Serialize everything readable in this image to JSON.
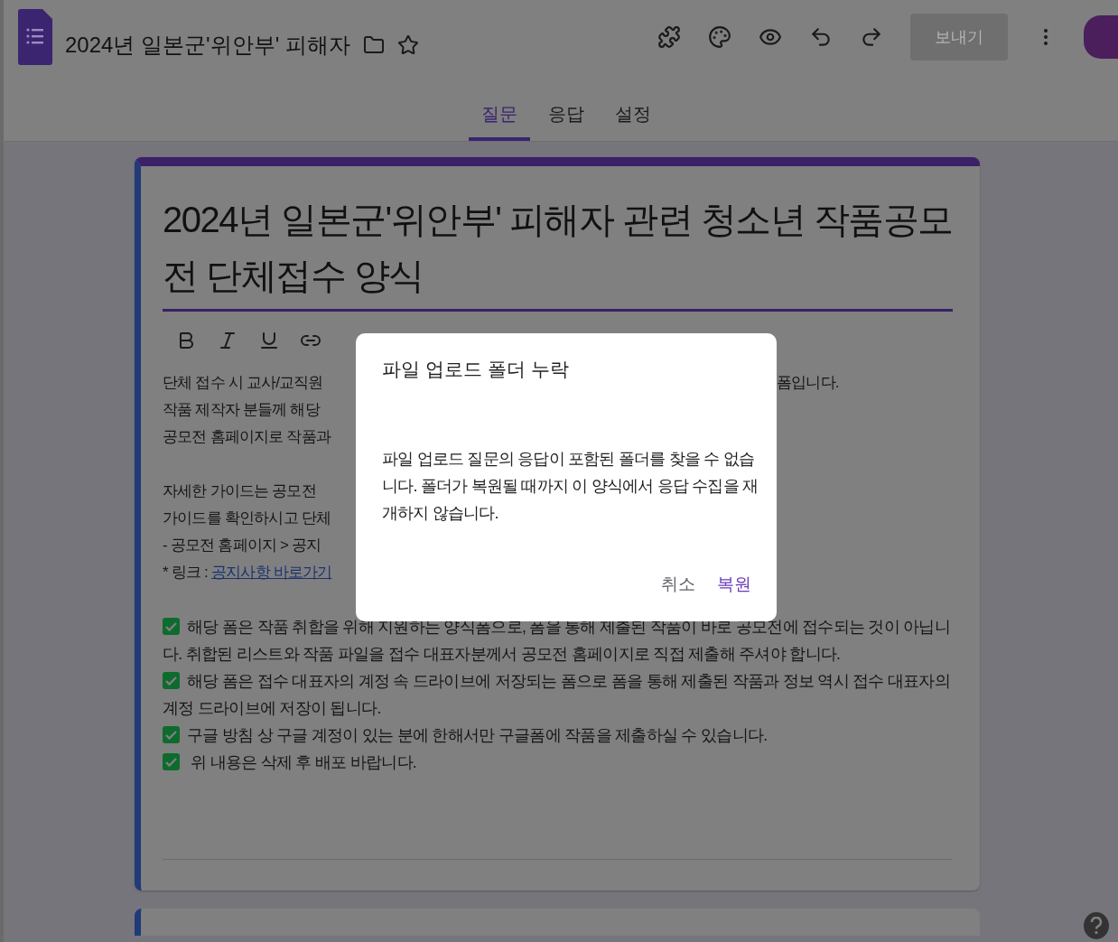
{
  "header": {
    "title": "2024년 일본군'위안부' 피해자",
    "send_button": "보내기"
  },
  "tabs": [
    {
      "label": "질문",
      "selected": true
    },
    {
      "label": "응답",
      "selected": false
    },
    {
      "label": "설정",
      "selected": false
    }
  ],
  "form": {
    "title": "2024년 일본군'위안부' 피해자 관련 청소년 작품공모전 단체접수 양식",
    "description_paragraphs": [
      [
        "단체 접수 시 교사/교직원",
        "작품 제작자 분들께 해당",
        "공모전 홈페이지로 작품과"
      ],
      [
        "자세한 가이드는 공모전",
        "가이드를 확인하시고 단체",
        "- 공모전 홈페이지 > 공지"
      ]
    ],
    "description_right": "폼입니다.",
    "link_line": {
      "label": "* 링크 : ",
      "link": "공지사항 바로가기"
    },
    "notices": [
      {
        "checked": true,
        "text": "해당 폼은 작품 취합을 위해 지원하는 양식폼으로, 폼을 통해 제출된 작품이 바로 공모전에 접수되는 것이 아닙니다. 취합된 리스트와 작품 파일을 접수 대표자분께서 공모전 홈페이지로 직접 제출해 주셔야 합니다."
      },
      {
        "checked": true,
        "text": "해당 폼은 접수 대표자의 계정 속 드라이브에 저장되는 폼으로 폼을 통해 제출된 작품과 정보 역시 접수 대표자의 계정 드라이브에 저장이 됩니다."
      },
      {
        "checked": true,
        "text": "구글 방침 상 구글 계정이 있는 분에 한해서만 구글폼에 작품을 제출하실 수 있습니다."
      },
      {
        "checked": true,
        "text": " 위 내용은 삭제 후 배포 바랍니다."
      }
    ]
  },
  "dialog": {
    "title": "파일 업로드 폴더 누락",
    "message": "파일 업로드 질문의 응답이 포함된 폴더를 찾을 수 없습니다. 폴더가 복원될 때까지 이 양식에서 응답 수집을 재개하지 않습니다.",
    "buttons": [
      {
        "label": "취소",
        "kind": "neutral"
      },
      {
        "label": "복원",
        "kind": "primary"
      }
    ]
  }
}
